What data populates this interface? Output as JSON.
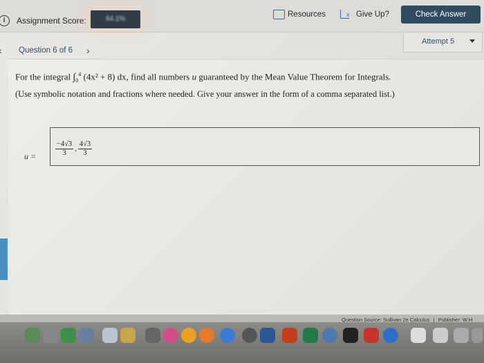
{
  "header": {
    "assignment_score_label": "Assignment Score:",
    "score_value": "64.1%",
    "resources_label": "Resources",
    "give_up_label": "Give Up?",
    "check_answer_label": "Check Answer"
  },
  "question_nav": {
    "title": "Question 6 of 6",
    "attempt_label": "Attempt 5"
  },
  "question": {
    "prefix": "For the integral",
    "integral_upper": "4",
    "integral_lower": "0",
    "integrand": "(4x² + 8) dx",
    "middle": ", find all numbers",
    "var": "u",
    "suffix": "guaranteed by the Mean Value Theorem for Integrals.",
    "note": "(Use symbolic notation and fractions where needed. Give your answer in the form of a comma separated list.)"
  },
  "answer": {
    "label": "u =",
    "frac1_num": "−4√3",
    "frac1_den": "3",
    "separator": ",",
    "frac2_num": "4√3",
    "frac2_den": "3"
  },
  "footer": {
    "source": "Question Source: Sullivan 2e Calculus",
    "publisher": "Publisher: W.H"
  },
  "colors": {
    "check_button": "#2f4b5e",
    "accent_blue": "#2f6fb6"
  }
}
